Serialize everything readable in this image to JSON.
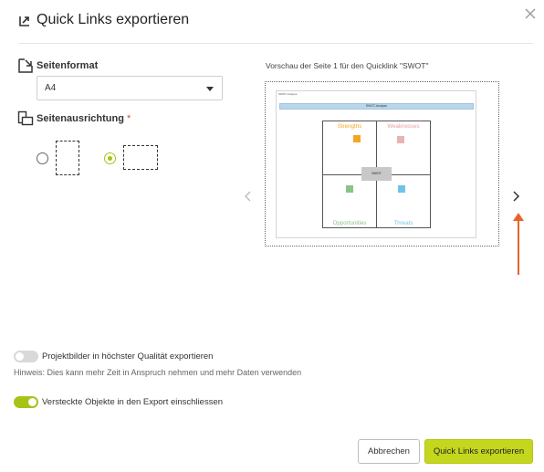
{
  "dialog": {
    "title": "Quick Links exportieren",
    "close_icon": "close-icon"
  },
  "settings": {
    "format_label": "Seitenformat",
    "format_icon": "page-format-icon",
    "format_value": "A4",
    "orientation_label": "Seitenausrichtung",
    "orientation_required_mark": "*",
    "orientation_icon": "page-orientation-icon",
    "orientations": [
      {
        "name": "portrait",
        "selected": false
      },
      {
        "name": "landscape",
        "selected": true
      }
    ]
  },
  "preview": {
    "label": "Vorschau der Seite 1 für den Quicklink \"SWOT\"",
    "prev_icon": "chevron-left-icon",
    "next_icon": "chevron-right-icon",
    "page": {
      "small_title": "SWOT-Analyse",
      "bar_title": "SWOT-Analyse",
      "center_label": "SWOT",
      "quadrants": [
        {
          "label": "Strengths",
          "color": "#f5a623",
          "square": "#f5a623"
        },
        {
          "label": "Weaknesses",
          "color": "#e6a0a0",
          "square": "#e6b4b4"
        },
        {
          "label": "Opportunities",
          "color": "#8cc38c",
          "square": "#88c488"
        },
        {
          "label": "Threats",
          "color": "#7ec3e6",
          "square": "#6ec4e8"
        }
      ]
    }
  },
  "options": {
    "hq_images": {
      "label": "Projektbilder in höchster Qualität exportieren",
      "enabled": false
    },
    "hint": "Hinweis: Dies kann mehr Zeit in Anspruch nehmen und mehr Daten verwenden",
    "hidden_objects": {
      "label": "Versteckte Objekte in den Export einschliessen",
      "enabled": true
    }
  },
  "buttons": {
    "cancel": "Abbrechen",
    "export": "Quick Links exportieren"
  },
  "colors": {
    "accent": "#c4d71e",
    "toggle_on": "#a8c316",
    "annotation_arrow": "#e8632a"
  }
}
